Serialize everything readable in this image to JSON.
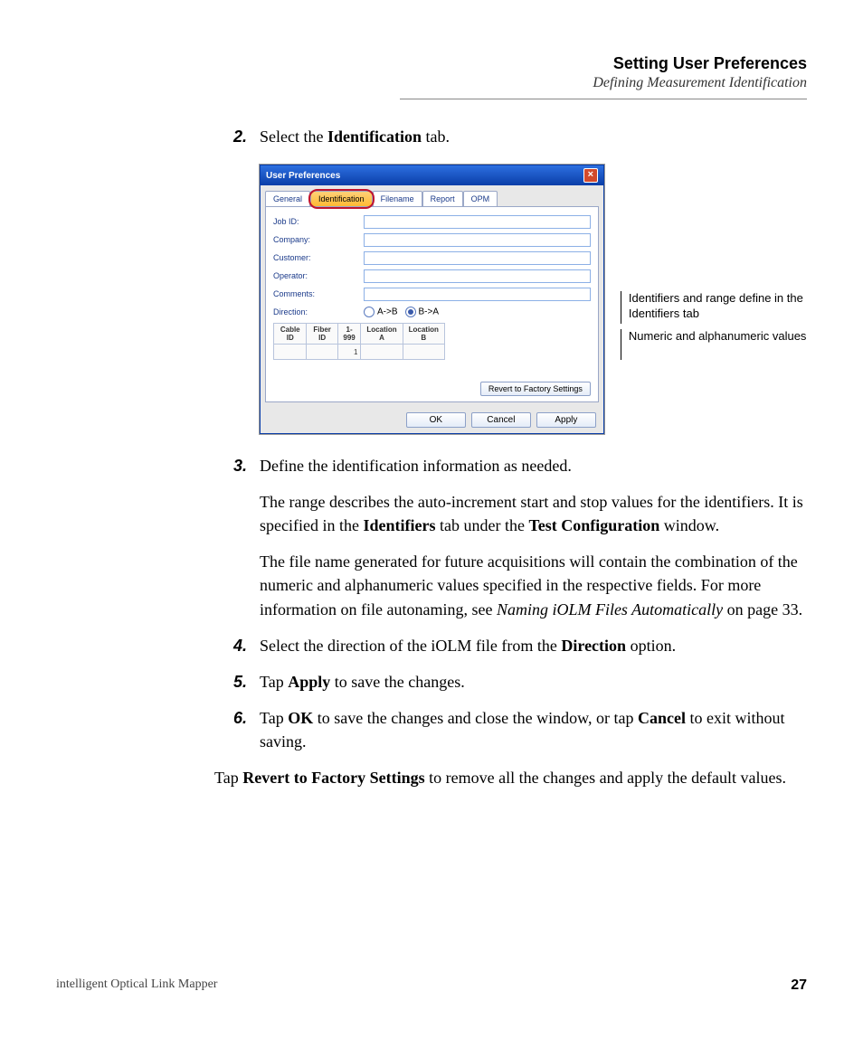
{
  "header": {
    "title": "Setting User Preferences",
    "subtitle": "Defining Measurement Identification"
  },
  "steps": {
    "s2": {
      "num": "2.",
      "t1a": "Select the ",
      "t1b": "Identification",
      "t1c": " tab."
    },
    "s3": {
      "num": "3.",
      "line1": "Define the identification information as needed.",
      "p2a": "The range describes the auto-increment start and stop values for the identifiers. It is specified in the ",
      "p2b": "Identifiers",
      "p2c": " tab under the ",
      "p2d": "Test Configuration",
      "p2e": " window.",
      "p3a": "The file name generated for future acquisitions will contain the combination of the numeric and alphanumeric values specified in the respective fields. For more information on file autonaming, see ",
      "p3b": "Naming iOLM Files Automatically",
      "p3c": " on page 33."
    },
    "s4": {
      "num": "4.",
      "a": "Select the direction of the iOLM file from the ",
      "b": "Direction",
      "c": " option."
    },
    "s5": {
      "num": "5.",
      "a": "Tap ",
      "b": "Apply",
      "c": " to save the changes."
    },
    "s6": {
      "num": "6.",
      "a": "Tap ",
      "b": "OK",
      "c": " to save the changes and close the window, or tap ",
      "d": "Cancel",
      "e": " to exit without saving."
    }
  },
  "tail": {
    "a": "Tap ",
    "b": "Revert to Factory Settings",
    "c": " to remove all the changes and apply the default values."
  },
  "dialog": {
    "title": "User Preferences",
    "tabs": {
      "general": "General",
      "identification": "Identification",
      "filename": "Filename",
      "report": "Report",
      "opm": "OPM"
    },
    "labels": {
      "job": "Job ID:",
      "company": "Company:",
      "customer": "Customer:",
      "operator": "Operator:",
      "comments": "Comments:",
      "direction": "Direction:"
    },
    "dir": {
      "ab": "A->B",
      "ba": "B->A"
    },
    "cols": {
      "cable": "Cable ID",
      "fiber": "Fiber ID",
      "range": "1-999",
      "locA": "Location A",
      "locB": "Location B"
    },
    "vals": {
      "rangeVal": "1"
    },
    "buttons": {
      "revert": "Revert to Factory Settings",
      "ok": "OK",
      "cancel": "Cancel",
      "apply": "Apply"
    }
  },
  "callouts": {
    "c1": "Identifiers and range define in the Identifiers tab",
    "c2": "Numeric and alphanumeric values"
  },
  "footer": {
    "left": "intelligent Optical Link Mapper",
    "right": "27"
  }
}
